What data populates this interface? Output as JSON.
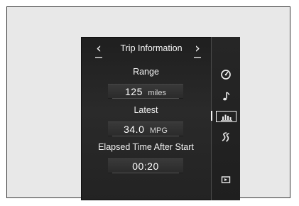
{
  "screen": {
    "title": "Trip Information",
    "nav": {
      "left": "‹",
      "right": "›"
    },
    "rows": [
      {
        "label": "Range",
        "value": "125",
        "unit": "miles"
      },
      {
        "label": "Latest",
        "value": "34.0",
        "unit": "MPG"
      },
      {
        "label": "Elapsed Time After Start",
        "value": "00:20",
        "unit": ""
      }
    ]
  },
  "side_icons": [
    {
      "name": "gauge-icon"
    },
    {
      "name": "music-note-icon"
    },
    {
      "name": "bar-chart-icon",
      "selected": true
    },
    {
      "name": "road-icon"
    },
    {
      "name": "media-play-icon"
    }
  ]
}
